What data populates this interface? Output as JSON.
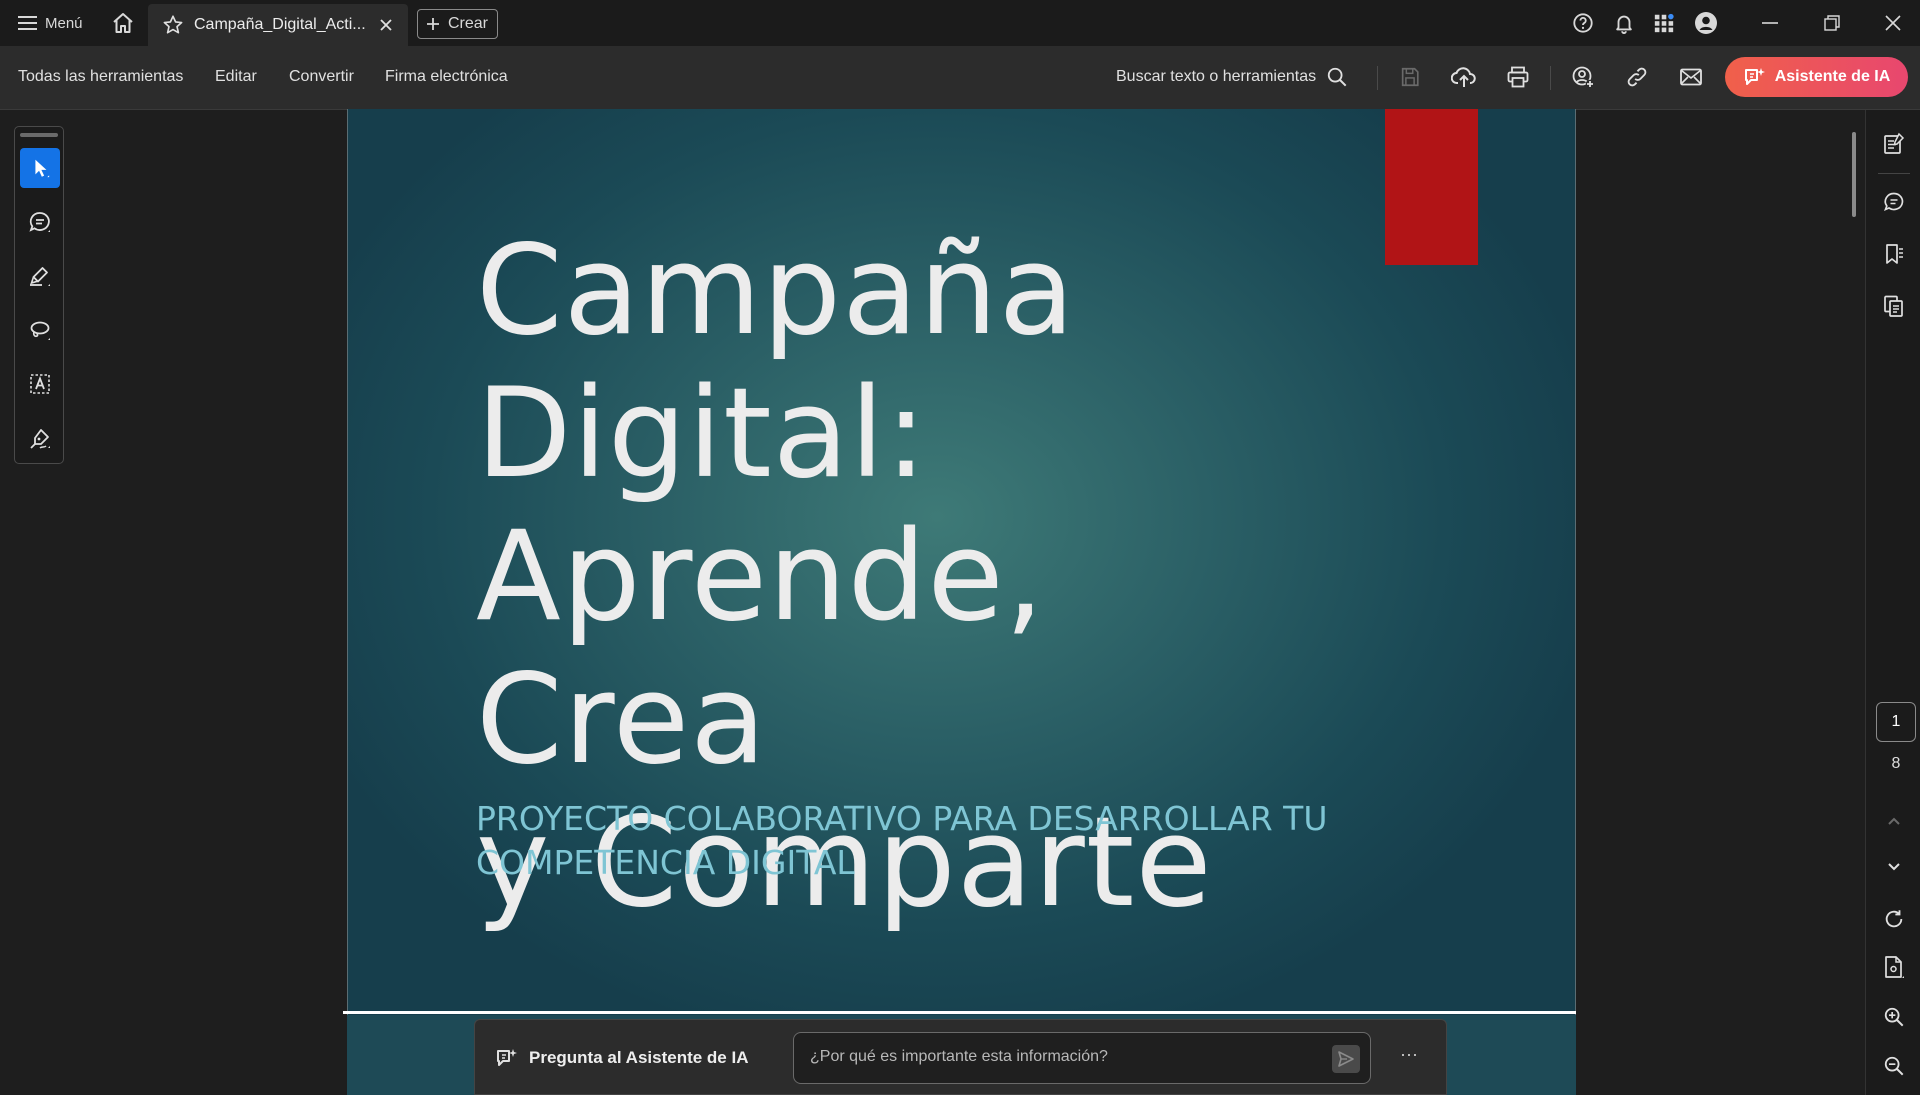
{
  "titlebar": {
    "menu_label": "Menú",
    "tab_title": "Campaña_Digital_Acti...",
    "create_label": "Crear"
  },
  "toolbar": {
    "menu": [
      "Todas las herramientas",
      "Editar",
      "Convertir",
      "Firma electrónica"
    ],
    "search_label": "Buscar texto o herramientas",
    "ai_button_label": "Asistente de IA"
  },
  "document": {
    "title_lines": [
      "Campaña",
      "Digital:",
      "Aprende, Crea",
      "y Comparte"
    ],
    "subtitle_lines": [
      "PROYECTO COLABORATIVO PARA DESARROLLAR TU",
      "COMPETENCIA DIGITAL"
    ]
  },
  "ai_bar": {
    "label": "Pregunta al Asistente de IA",
    "placeholder": "¿Por qué es importante esta información?",
    "more_label": "···"
  },
  "pagination": {
    "current": "1",
    "total": "8"
  },
  "colors": {
    "accent_blue": "#1473e6",
    "ai_gradient_start": "#f0604a",
    "ai_gradient_end": "#e8476f",
    "slide_red_tab": "#b11416",
    "subtitle_color": "#7fc5d4"
  }
}
